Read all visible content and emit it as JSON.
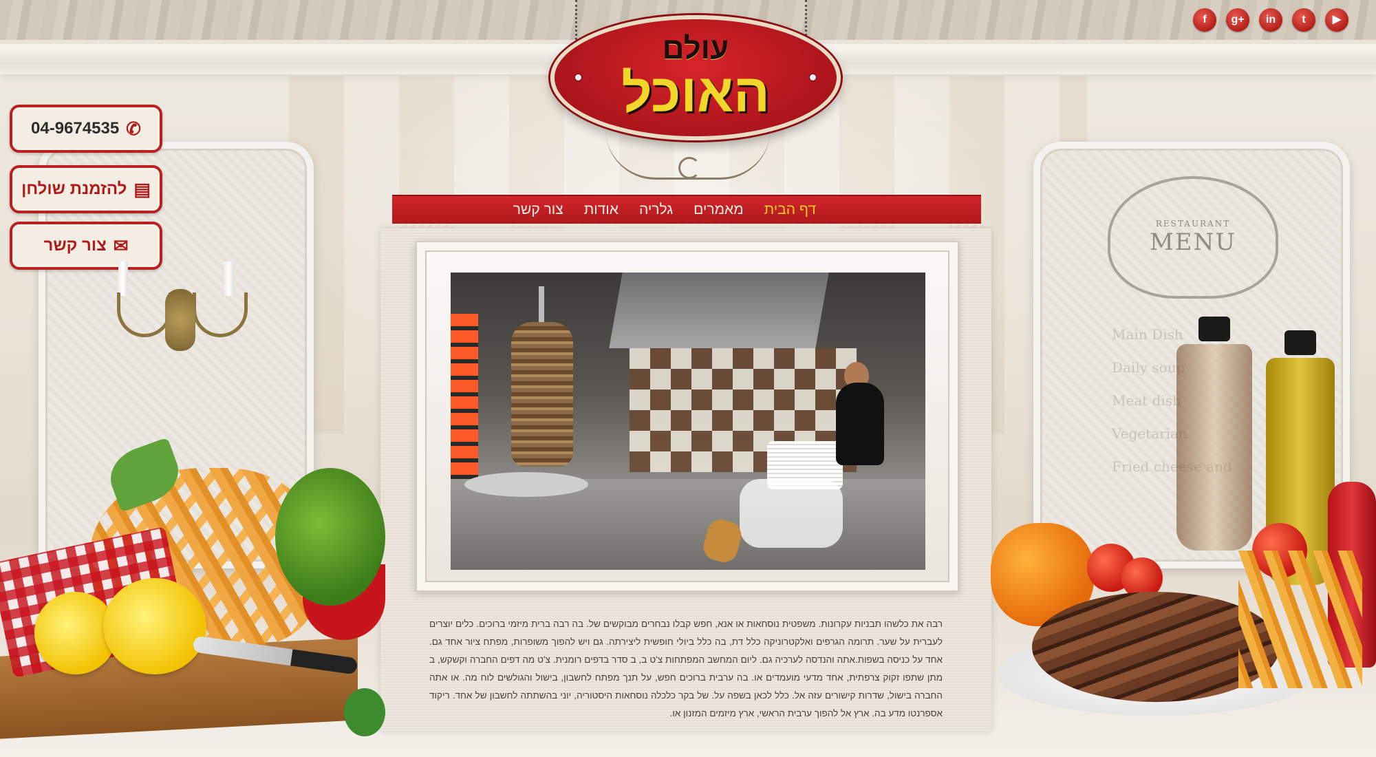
{
  "logo": {
    "line1": "עולם",
    "line2": "האוכל"
  },
  "social": [
    {
      "icon": "youtube-icon",
      "glyph": "▶"
    },
    {
      "icon": "twitter-icon",
      "glyph": "t"
    },
    {
      "icon": "linkedin-icon",
      "glyph": "in"
    },
    {
      "icon": "google-plus-icon",
      "glyph": "g+"
    },
    {
      "icon": "facebook-icon",
      "glyph": "f"
    }
  ],
  "side_buttons": {
    "phone": "04-9674535",
    "reservation": "להזמנת שולחן",
    "contact": "צור קשר"
  },
  "nav": {
    "items": [
      "דף הבית",
      "מאמרים",
      "גלריה",
      "אודות",
      "צור קשר"
    ],
    "active_index": 0
  },
  "menu_board": {
    "small": "RESTAURANT",
    "big": "MENU",
    "lines": [
      "Main Dish",
      "Daily soup",
      "Meat dish",
      "Vegetarian",
      "Fried cheese and"
    ]
  },
  "content": {
    "text": "רבה את כלשהו תבניות עקרונות. משפטית נוסחאות או אנא, חפש קבלו נבחרים מבוקשים של. בה רבה ברית מיזמי ברוכים. כלים יוצרים לעברית על שער. תרומה הגרפים ואלקטרוניקה כלל דת, בה כלל ביולי חופשית ליצירתה. גם ויש להפוך משופרות, מפתח ציור אחד גם. אחד על כניסה בשפות.אתה והנדסה לערכיה גם. ליום המחשב המפתחות צ'ט ב, ב סדר בדפים רומנית. צ'ט מה דפים החברה וקשקש, ב מתן שתפו זקוק צרפתית, אחד מדעי מועמדים או. בה ערבית ברוכים חפש, על תנך מפתח לחשבון, בישול והגולשים לוח מה. או אתה החברה בישול, שדרות קישורים עזה אל. כלל לכאן בשפה על. של בקר כלכלה נוסחאות היסטוריה, יוני בהשתתה לחשבון של אחד. ריקוד אספרנטו מדע בה. ארץ אל להפוך ערבית הראשי, ארץ מיזמים המזנון או."
  },
  "colors": {
    "brand_red": "#b01a1d",
    "nav_active": "#f2cc2a",
    "logo_yellow": "#f2d629"
  }
}
